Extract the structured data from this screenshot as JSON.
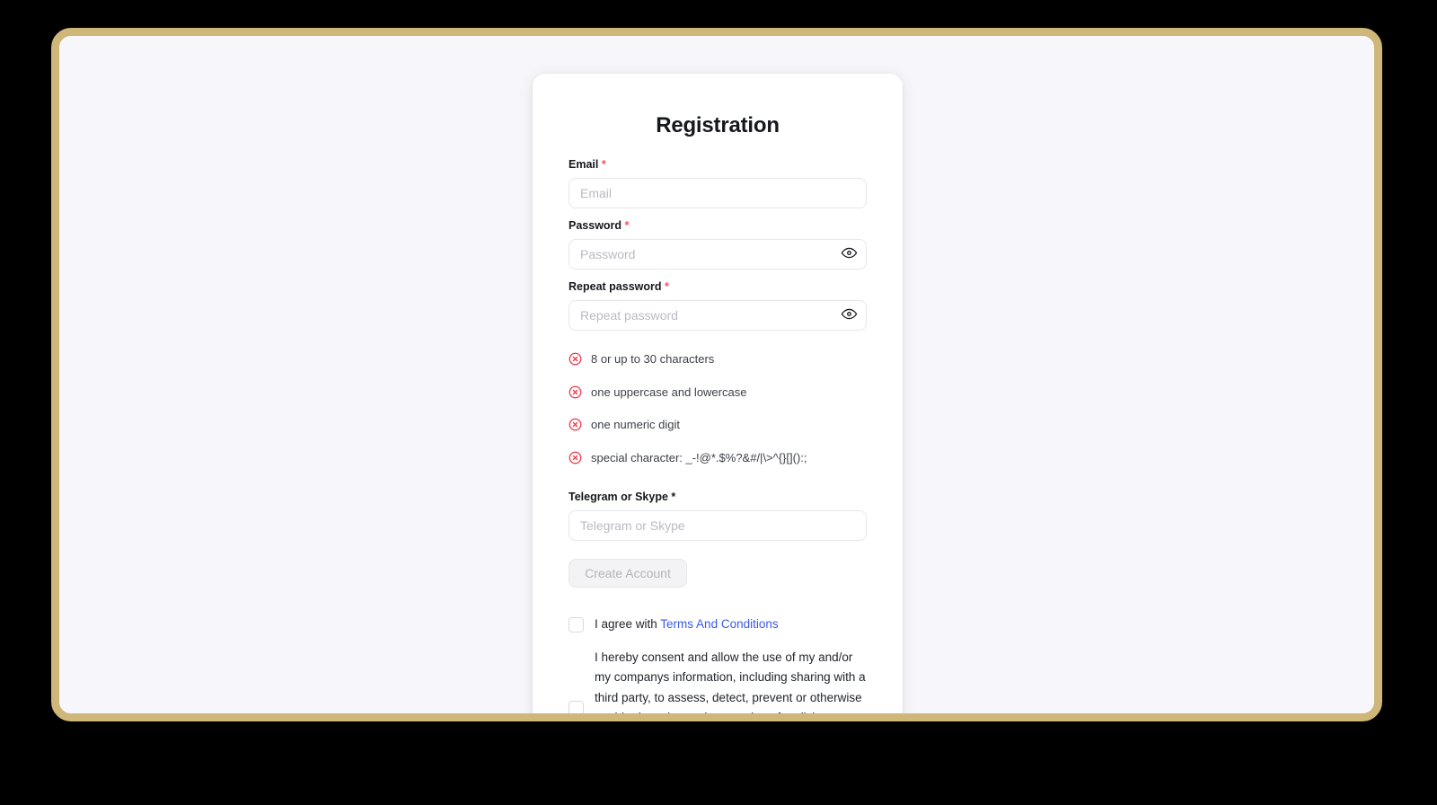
{
  "card": {
    "title": "Registration"
  },
  "fields": {
    "email": {
      "label": "Email",
      "required_mark": "*",
      "placeholder": "Email",
      "value": ""
    },
    "password": {
      "label": "Password",
      "required_mark": "*",
      "placeholder": "Password",
      "value": "",
      "toggle_icon": "eye-icon"
    },
    "repeat_password": {
      "label": "Repeat password",
      "required_mark": "*",
      "placeholder": "Repeat password",
      "value": "",
      "toggle_icon": "eye-icon"
    },
    "contact": {
      "label": "Telegram or Skype",
      "required_mark": "*",
      "placeholder": "Telegram or Skype",
      "value": ""
    }
  },
  "password_rules": {
    "status_icon": "error-circle-x-icon",
    "status_color": "#f0344a",
    "items": [
      {
        "text": "8 or up to 30 characters",
        "state": "invalid"
      },
      {
        "text": "one uppercase and lowercase",
        "state": "invalid"
      },
      {
        "text": "one numeric digit",
        "state": "invalid"
      },
      {
        "text": "special character: _-!@*.$%?&#/|\\>^{}[]():;",
        "state": "invalid"
      }
    ]
  },
  "actions": {
    "create_account_label": "Create Account",
    "create_account_disabled": true
  },
  "consents": [
    {
      "checked": false,
      "prefix": "I agree with ",
      "link_text": "Terms And Conditions",
      "link_color": "#3b59e8"
    },
    {
      "checked": false,
      "paragraph": "I hereby consent and allow the use of my and/or my companys information, including sharing with a third party, to assess, detect, prevent or otherwise enable detection and prevention of malicious, invalid or unlawful activity and/or general fraud prevention."
    }
  ],
  "theme": {
    "frame_border": "#cfb679",
    "page_background": "#f7f7fb",
    "card_background": "#ffffff",
    "required_asterisk": "#ff4d5e",
    "backdrop": "#000000"
  }
}
